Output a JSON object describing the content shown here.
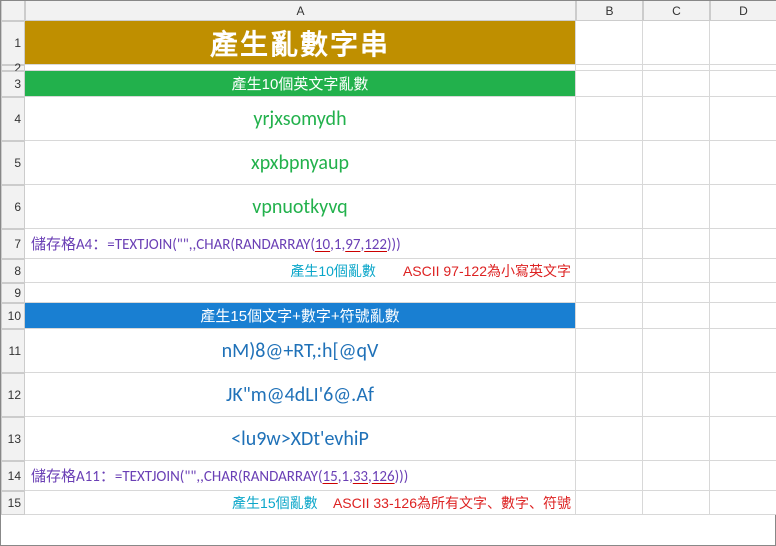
{
  "columns": [
    "A",
    "B",
    "C",
    "D"
  ],
  "rows": [
    "1",
    "2",
    "3",
    "4",
    "5",
    "6",
    "7",
    "8",
    "9",
    "10",
    "11",
    "12",
    "13",
    "14",
    "15"
  ],
  "title": "產生亂數字串",
  "section1": {
    "header": "產生10個英文字亂數",
    "values": [
      "yrjxsomydh",
      "xpxbpnyaup",
      "vpnuotkyvq"
    ],
    "formula_prefix": "儲存格A4：",
    "formula_eq": "=TEXTJOIN(\"\",,CHAR(RANDARRAY(",
    "p_count": "10",
    "p_sep1": ",1,",
    "p_lo": "97",
    "p_sep2": ",",
    "p_hi": "122",
    "formula_tail": ")))",
    "note_left": "產生10個亂數",
    "note_right": "ASCII 97-122為小寫英文字"
  },
  "section2": {
    "header": "產生15個文字+數字+符號亂數",
    "values": [
      "nM)8@+RT,:h[@qV",
      "JK\"m@4dLI'6@.Af",
      "<lu9w>XDt'evhiP"
    ],
    "formula_prefix": "儲存格A11：",
    "formula_eq": "=TEXTJOIN(\"\",,CHAR(RANDARRAY(",
    "p_count": "15",
    "p_sep1": ",1,",
    "p_lo": "33",
    "p_sep2": ",",
    "p_hi": "126",
    "formula_tail": ")))",
    "note_left": "產生15個亂數",
    "note_right": "ASCII 33-126為所有文字、數字、符號"
  }
}
